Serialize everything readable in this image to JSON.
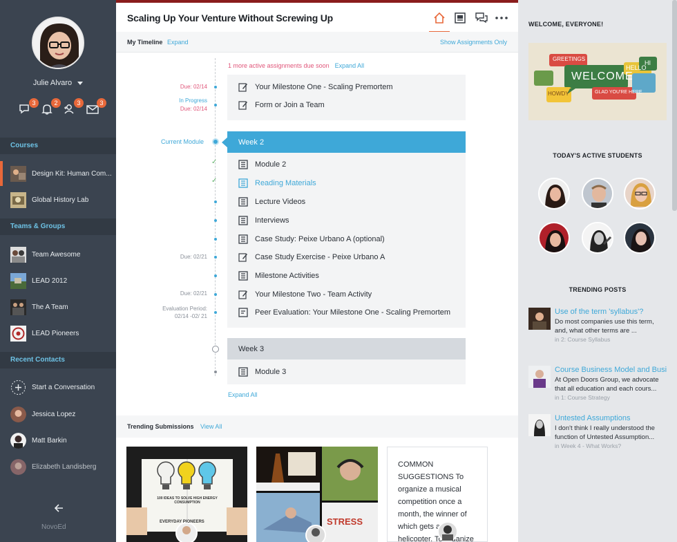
{
  "sidebar": {
    "user_name": "Julie Alvaro",
    "notifications": [
      {
        "name": "messages",
        "icon": "chat-icon",
        "count": "3"
      },
      {
        "name": "alerts",
        "icon": "bell-icon",
        "count": "2"
      },
      {
        "name": "requests",
        "icon": "user-add-icon",
        "count": "3"
      },
      {
        "name": "mail",
        "icon": "mail-icon",
        "count": "3"
      }
    ],
    "courses_heading": "Courses",
    "courses": [
      {
        "label": "Design Kit: Human Com..."
      },
      {
        "label": "Global History Lab"
      }
    ],
    "teams_heading": "Teams & Groups",
    "teams": [
      {
        "label": "Team Awesome"
      },
      {
        "label": "LEAD 2012"
      },
      {
        "label": "The A Team"
      },
      {
        "label": "LEAD Pioneers"
      }
    ],
    "contacts_heading": "Recent Contacts",
    "start_conversation": "Start a Conversation",
    "contacts": [
      {
        "label": "Jessica Lopez"
      },
      {
        "label": "Matt Barkin"
      },
      {
        "label": "Elizabeth Landisberg"
      }
    ],
    "brand": "NovoEd"
  },
  "header": {
    "title": "Scaling Up Your Venture Without Screwing Up"
  },
  "timeline": {
    "label": "My Timeline",
    "expand": "Expand",
    "show_assignments": "Show Assignments Only",
    "warning": "1 more active assignments due soon",
    "expand_all": "Expand All",
    "current_module": "Current Module",
    "top_items": [
      {
        "label": "Your Milestone One - Scaling Premortem",
        "due": "Due: 02/14"
      },
      {
        "label": "Form or Join a Team",
        "due_status": "In Progress",
        "due": "Due: 02/14"
      }
    ],
    "week2": {
      "title": "Week 2",
      "items": [
        {
          "label": "Module 2",
          "icon": "module-icon"
        },
        {
          "label": "Reading Materials",
          "icon": "reading-icon"
        },
        {
          "label": "Lecture Videos",
          "icon": "module-icon"
        },
        {
          "label": "Interviews",
          "icon": "module-icon"
        },
        {
          "label": "Case Study: Peixe Urbano A (optional)",
          "icon": "module-icon"
        },
        {
          "label": "Case Study Exercise - Peixe Urbano A",
          "icon": "edit-icon",
          "due": "Due: 02/21"
        },
        {
          "label": "Milestone Activities",
          "icon": "module-icon"
        },
        {
          "label": "Your Milestone Two - Team Activity",
          "icon": "edit-icon",
          "due": "Due: 02/21"
        },
        {
          "label": "Peer Evaluation: Your Milestone One - Scaling Premortem",
          "icon": "evaluation-icon",
          "due_line1": "Evaluation Period:",
          "due_line2": "02/14 -02/ 21"
        }
      ]
    },
    "week3": {
      "title": "Week 3",
      "items": [
        {
          "label": "Module 3",
          "icon": "module-icon"
        }
      ]
    },
    "bottom_expand_all": "Expand All"
  },
  "trending_submissions": {
    "label": "Trending Submissions",
    "view_all": "View All",
    "card1_caption": "100 IDEAS TO SOLVE HIGH ENERGY CONSUMPTION",
    "card1_footer": "EVERYDAY PIONEERS",
    "card3_text": "COMMON SUGGESTIONS To organize a musical competition once a month, the winner of which gets a helicopter. To organize a charity mu     ncert to"
  },
  "right_panel": {
    "welcome_heading": "WELCOME, EVERYONE!",
    "welcome_img_words": [
      "GREETINGS",
      "WELCOME",
      "HELLO",
      "HI",
      "HOWDY",
      "GLAD YOU'RE HERE"
    ],
    "students_heading": "TODAY'S ACTIVE STUDENTS",
    "trending_heading": "TRENDING POSTS",
    "posts": [
      {
        "title": "Use of the term 'syllabus'?",
        "excerpt1": "Do most companies use this term,",
        "excerpt2": "and, what other terms are ...",
        "meta": "in 2: Course Syllabus"
      },
      {
        "title": "Course Business Model and Busi",
        "excerpt1": "At Open Doors Group, we advocate",
        "excerpt2": "that all education and each cours...",
        "meta": "in 1: Course Strategy"
      },
      {
        "title": "Untested Assumptions",
        "excerpt1": "I don't think I really understood the",
        "excerpt2": "function of Untested Assumption...",
        "meta": "in Week 4 - What Works?"
      }
    ]
  },
  "colors": {
    "sidebar_bg": "#3b4450",
    "accent_orange": "#e8683a",
    "accent_blue": "#3ea8d8",
    "due_pink": "#e0567a",
    "top_border": "#8a1c1c"
  }
}
